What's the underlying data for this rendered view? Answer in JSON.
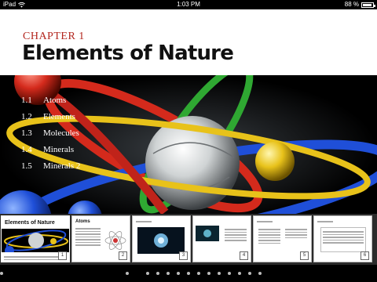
{
  "status_bar": {
    "device": "iPad",
    "time": "1:03 PM",
    "battery": "88 %",
    "battery_level": 0.88
  },
  "chapter": {
    "label": "CHAPTER 1",
    "title": "Elements of Nature"
  },
  "toc": [
    {
      "number": "1.1",
      "title": "Atoms"
    },
    {
      "number": "1.2",
      "title": "Elements"
    },
    {
      "number": "1.3",
      "title": "Molecules"
    },
    {
      "number": "1.4",
      "title": "Minerals"
    },
    {
      "number": "1.5",
      "title": "Minerals 2"
    }
  ],
  "thumbnails": [
    {
      "title": "Elements of Nature",
      "page": "1"
    },
    {
      "title": "Atoms",
      "page": "2"
    },
    {
      "title": "",
      "page": "3"
    },
    {
      "title": "",
      "page": "4"
    },
    {
      "title": "",
      "page": "5"
    },
    {
      "title": "",
      "page": "6"
    }
  ],
  "pager": {
    "current_page": 1,
    "total_dots": 14
  },
  "colors": {
    "chapter_label": "#b3261e",
    "ring_red": "#d42a1c",
    "ring_green": "#2fa832",
    "ring_blue": "#1f4fd8",
    "ring_yellow": "#e8c21a"
  }
}
